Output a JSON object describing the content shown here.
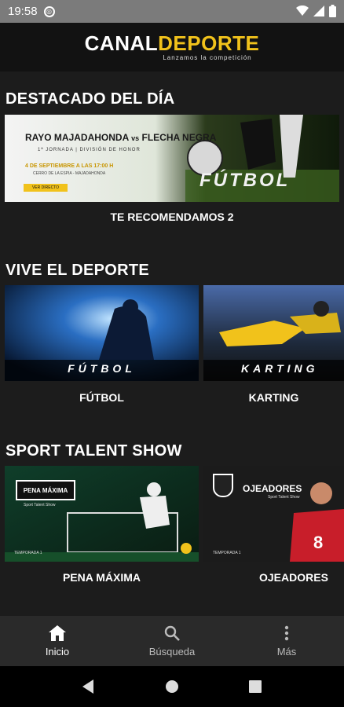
{
  "status_bar": {
    "time": "19:58"
  },
  "app": {
    "logo_part1": "CANAL",
    "logo_part2": "DEPORTE",
    "tagline": "Lanzamos la competición",
    "brand_yellow": "#f1c21b"
  },
  "sections": [
    {
      "title": "DESTACADO DEL DÍA",
      "items": [
        {
          "caption": "TE RECOMENDAMOS 2",
          "banner": {
            "team1": "RAYO MAJADAHONDA",
            "vs": "vs",
            "team2": "FLECHA NEGRA",
            "subtitle": "1ª JORNADA | DIVISIÓN DE HONOR",
            "date": "4 DE SEPTIEMBRE A LAS 17:00 H",
            "venue": "CERRO DE LA ESPIA - MAJADAHONDA",
            "cta": "VER DIRECTO",
            "big_text": "FÚTBOL"
          }
        }
      ]
    },
    {
      "title": "VIVE EL DEPORTE",
      "items": [
        {
          "caption": "FÚTBOL",
          "overlay": "FÚTBOL"
        },
        {
          "caption": "KARTING",
          "overlay": "KARTING"
        }
      ]
    },
    {
      "title": "SPORT TALENT SHOW",
      "items": [
        {
          "caption": "PENA MÁXIMA",
          "badge": "PENA MÁXIMA",
          "badge_sub": "Sport Talent Show",
          "season": "TEMPORADA 1"
        },
        {
          "caption": "OJEADORES",
          "badge": "OJEADORES",
          "badge_sub": "Sport Talent Show",
          "season": "TEMPORADA 1"
        }
      ]
    }
  ],
  "bottom_nav": {
    "items": [
      {
        "label": "Inicio",
        "icon": "home-icon",
        "active": true
      },
      {
        "label": "Búsqueda",
        "icon": "search-icon",
        "active": false
      },
      {
        "label": "Más",
        "icon": "more-vert-icon",
        "active": false
      }
    ]
  }
}
